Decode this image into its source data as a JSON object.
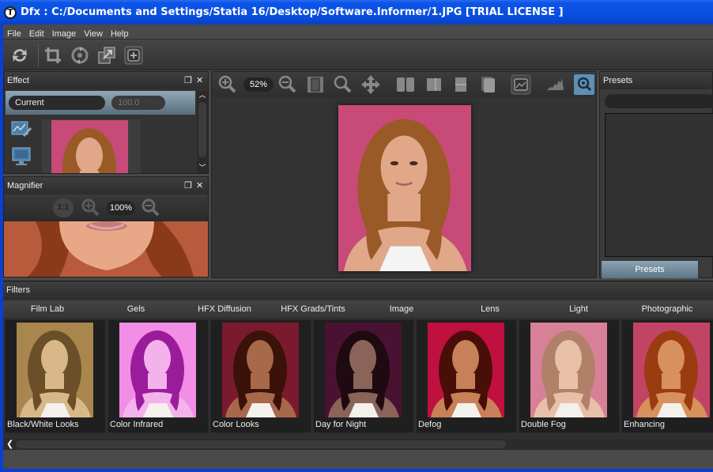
{
  "window": {
    "title": "Dfx : C:/Documents and Settings/Statia 16/Desktop/Software.Informer/1.JPG [TRIAL LICENSE ]",
    "app_icon": "T"
  },
  "menu": [
    "File",
    "Edit",
    "Image",
    "View",
    "Help"
  ],
  "toolbar": {
    "icons": [
      "refresh-icon",
      "crop-icon",
      "rotate-icon",
      "resize-icon",
      "fit-screen-icon"
    ]
  },
  "effect_panel": {
    "title": "Effect",
    "restore_glyph": "❐",
    "close_glyph": "✕",
    "preset_name": "Current",
    "amount": "100.0",
    "scroll_up": "︿",
    "scroll_down": "﹀"
  },
  "magnifier_panel": {
    "title": "Magnifier",
    "restore_glyph": "❐",
    "close_glyph": "✕",
    "one_to_one": "1:1",
    "zoom": "100%"
  },
  "viewer": {
    "zoom": "52%",
    "tools": [
      "zoom-in",
      "zoom-out",
      "fit-frame",
      "zoom-tool",
      "pan-tool",
      "split-view",
      "split-vertical",
      "split-horizontal",
      "before-after",
      "fit-image",
      "histogram",
      "loupe"
    ]
  },
  "presets_panel": {
    "title": "Presets",
    "tab_label": "Presets"
  },
  "filters_panel": {
    "title": "Filters",
    "categories": [
      "Film Lab",
      "Gels",
      "HFX Diffusion",
      "HFX Grads/Tints",
      "Image",
      "Lens",
      "Light",
      "Photographic"
    ],
    "thumbnails": [
      {
        "label": "Black/White Looks",
        "bg": "#a8864e",
        "hair": "#6b4f28",
        "skin": "#d8b888"
      },
      {
        "label": "Color Infrared",
        "bg": "#f28ee6",
        "hair": "#9a1c9a",
        "skin": "#f4b2ec"
      },
      {
        "label": "Color Looks",
        "bg": "#7a1a2e",
        "hair": "#3a1208",
        "skin": "#a8684a"
      },
      {
        "label": "Day for Night",
        "bg": "#4a1232",
        "hair": "#1e0a10",
        "skin": "#8a6458"
      },
      {
        "label": "Defog",
        "bg": "#c01040",
        "hair": "#4a0e08",
        "skin": "#c88058"
      },
      {
        "label": "Double Fog",
        "bg": "#d88098",
        "hair": "#b08068",
        "skin": "#e8c0a8"
      },
      {
        "label": "Enhancing",
        "bg": "#c24464",
        "hair": "#9a3c10",
        "skin": "#d8905c"
      }
    ]
  },
  "colors": {
    "titlebar": "#0a4fe0",
    "panel_bg": "#333333",
    "accent_tab": "#7890a2",
    "photo_bg": "#c84a78",
    "hair": "#9a5a28",
    "skin": "#e0a888"
  }
}
